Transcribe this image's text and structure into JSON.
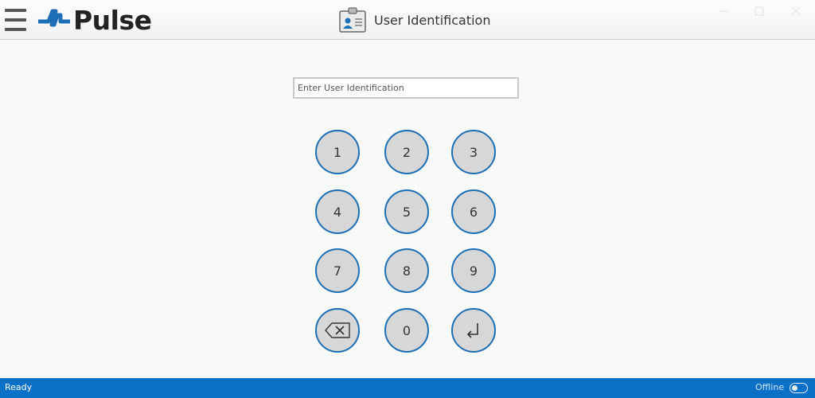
{
  "header": {
    "brand": "Pulse",
    "title": "User Identification",
    "window_controls": [
      "minimize",
      "maximize",
      "close"
    ]
  },
  "login": {
    "placeholder": "Enter User Identification",
    "value": ""
  },
  "keypad": {
    "k1": "1",
    "k2": "2",
    "k3": "3",
    "k4": "4",
    "k5": "5",
    "k6": "6",
    "k7": "7",
    "k8": "8",
    "k9": "9",
    "k0": "0",
    "backspace_icon": "backspace-icon",
    "enter_icon": "enter-icon"
  },
  "status": {
    "text": "Ready",
    "connection": "Offline",
    "online": false
  },
  "colors": {
    "accent": "#1c6fb5",
    "status_bar": "#0a70c8",
    "key_fill": "#d7d7d7"
  }
}
